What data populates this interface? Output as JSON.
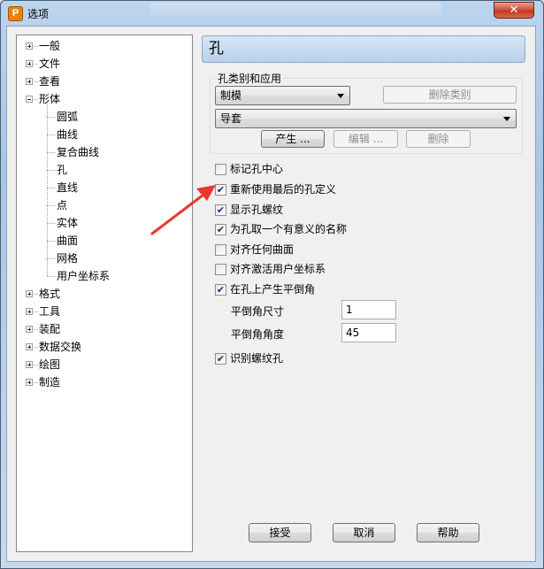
{
  "window": {
    "title": "选项",
    "app_icon_letter": "P",
    "close_glyph": "✕"
  },
  "tree": {
    "items": [
      {
        "label": "一般",
        "level": 0,
        "expander": "plus"
      },
      {
        "label": "文件",
        "level": 0,
        "expander": "plus"
      },
      {
        "label": "查看",
        "level": 0,
        "expander": "plus"
      },
      {
        "label": "形体",
        "level": 0,
        "expander": "minus"
      },
      {
        "label": "圆弧",
        "level": 1
      },
      {
        "label": "曲线",
        "level": 1
      },
      {
        "label": "复合曲线",
        "level": 1
      },
      {
        "label": "孔",
        "level": 1
      },
      {
        "label": "直线",
        "level": 1
      },
      {
        "label": "点",
        "level": 1
      },
      {
        "label": "实体",
        "level": 1
      },
      {
        "label": "曲面",
        "level": 1
      },
      {
        "label": "网格",
        "level": 1
      },
      {
        "label": "用户坐标系",
        "level": 1
      },
      {
        "label": "格式",
        "level": 0,
        "expander": "plus"
      },
      {
        "label": "工具",
        "level": 0,
        "expander": "plus"
      },
      {
        "label": "装配",
        "level": 0,
        "expander": "plus"
      },
      {
        "label": "数据交换",
        "level": 0,
        "expander": "plus"
      },
      {
        "label": "绘图",
        "level": 0,
        "expander": "plus"
      },
      {
        "label": "制造",
        "level": 0,
        "expander": "plus"
      }
    ]
  },
  "panel": {
    "heading": "孔",
    "group": {
      "label": "孔类别和应用",
      "category_select": "制模",
      "delete_category_button": "删除类别",
      "application_select": "导套",
      "create_button": "产生 ...",
      "edit_button": "编辑 ...",
      "delete_button": "删除"
    },
    "options": [
      {
        "label": "标记孔中心",
        "checked": false
      },
      {
        "label": "重新使用最后的孔定义",
        "checked": true
      },
      {
        "label": "显示孔螺纹",
        "checked": true
      },
      {
        "label": "为孔取一个有意义的名称",
        "checked": true
      },
      {
        "label": "对齐任何曲面",
        "checked": false
      },
      {
        "label": "对齐激活用户坐标系",
        "checked": false
      },
      {
        "label": "在孔上产生平倒角",
        "checked": true
      }
    ],
    "chamfer_size_label": "平倒角尺寸",
    "chamfer_size_value": "1",
    "chamfer_angle_label": "平倒角角度",
    "chamfer_angle_value": "45",
    "recognize_thread": {
      "label": "识别螺纹孔",
      "checked": true
    }
  },
  "footer": {
    "ok": "接受",
    "cancel": "取消",
    "help": "帮助"
  },
  "annotation": {
    "arrow_color": "#e8372c"
  },
  "check_glyph": "✔"
}
